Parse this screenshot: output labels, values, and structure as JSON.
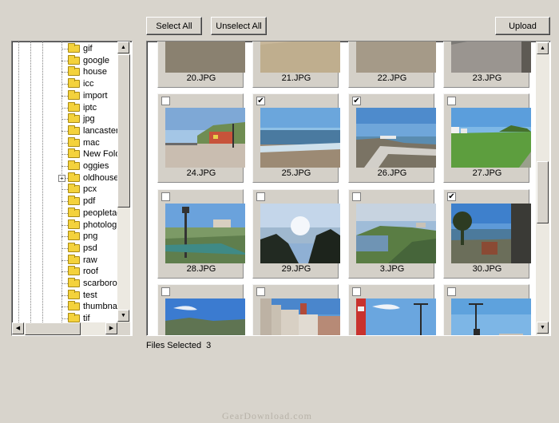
{
  "toolbar": {
    "select_all": "Select All",
    "unselect_all": "Unselect All",
    "upload": "Upload"
  },
  "tree": {
    "items": [
      {
        "label": "gif",
        "expandable": false
      },
      {
        "label": "google",
        "expandable": false
      },
      {
        "label": "house",
        "expandable": false
      },
      {
        "label": "icc",
        "expandable": false
      },
      {
        "label": "import",
        "expandable": false
      },
      {
        "label": "iptc",
        "expandable": false
      },
      {
        "label": "jpg",
        "expandable": false
      },
      {
        "label": "lancaster",
        "expandable": false
      },
      {
        "label": "mac",
        "expandable": false
      },
      {
        "label": "New Fold",
        "expandable": false
      },
      {
        "label": "oggies",
        "expandable": false
      },
      {
        "label": "oldhouse",
        "expandable": true
      },
      {
        "label": "pcx",
        "expandable": false
      },
      {
        "label": "pdf",
        "expandable": false
      },
      {
        "label": "peopletag",
        "expandable": false
      },
      {
        "label": "photolog",
        "expandable": false
      },
      {
        "label": "png",
        "expandable": false
      },
      {
        "label": "psd",
        "expandable": false
      },
      {
        "label": "raw",
        "expandable": false
      },
      {
        "label": "roof",
        "expandable": false
      },
      {
        "label": "scarborou",
        "expandable": false
      },
      {
        "label": "test",
        "expandable": false
      },
      {
        "label": "thumbnai",
        "expandable": false
      },
      {
        "label": "tif",
        "expandable": false
      }
    ]
  },
  "gallery": {
    "rows": [
      [
        {
          "name": "20.JPG",
          "checked": null,
          "scene": "beach-top"
        },
        {
          "name": "21.JPG",
          "checked": null,
          "scene": "sand-top"
        },
        {
          "name": "22.JPG",
          "checked": null,
          "scene": "rocks-top"
        },
        {
          "name": "23.JPG",
          "checked": null,
          "scene": "prom-top"
        }
      ],
      [
        {
          "name": "24.JPG",
          "checked": false,
          "scene": "promenade"
        },
        {
          "name": "25.JPG",
          "checked": true,
          "scene": "sea-beach"
        },
        {
          "name": "26.JPG",
          "checked": true,
          "scene": "seawall"
        },
        {
          "name": "27.JPG",
          "checked": false,
          "scene": "green-field"
        }
      ],
      [
        {
          "name": "28.JPG",
          "checked": false,
          "scene": "lamppost"
        },
        {
          "name": "29.JPG",
          "checked": false,
          "scene": "dark-sea"
        },
        {
          "name": "3.JPG",
          "checked": false,
          "scene": "headland"
        },
        {
          "name": "30.JPG",
          "checked": true,
          "scene": "bay-tree"
        }
      ],
      [
        {
          "name": "",
          "checked": false,
          "scene": "sky-bay"
        },
        {
          "name": "",
          "checked": false,
          "scene": "town"
        },
        {
          "name": "",
          "checked": false,
          "scene": "red-crane"
        },
        {
          "name": "",
          "checked": false,
          "scene": "cranes"
        }
      ]
    ]
  },
  "status": {
    "files_selected_label": "Files Selected",
    "files_selected_count": "3"
  },
  "watermark": "GearDownload.com",
  "icons": {
    "folder": "folder-icon",
    "check": "✔",
    "arrow_up": "▲",
    "arrow_down": "▼",
    "arrow_left": "◀",
    "arrow_right": "▶",
    "expand": "+"
  }
}
